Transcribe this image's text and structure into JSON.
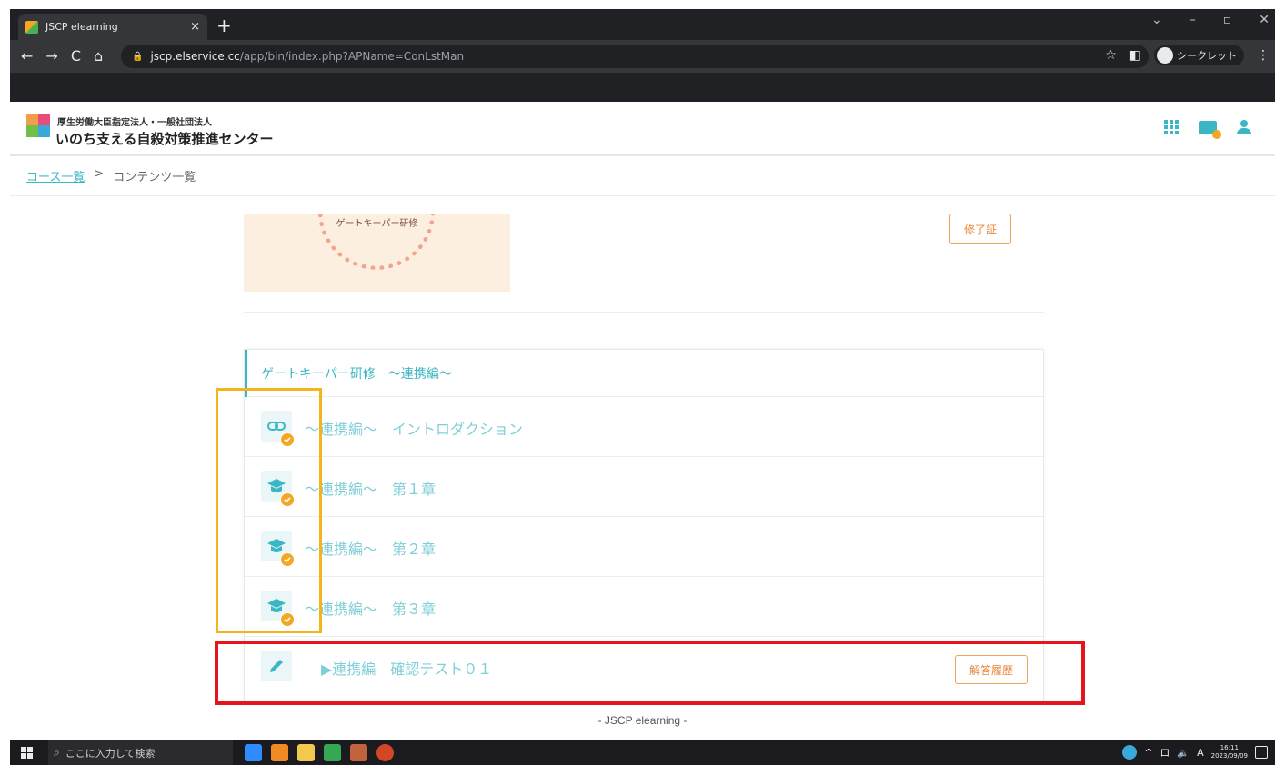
{
  "browser": {
    "tab_title": "JSCP elearning",
    "tab_close": "×",
    "new_tab": "+",
    "url_host": "jscp.elservice.cc",
    "url_path": "/app/bin/index.php?APName=ConLstMan",
    "incognito_label": "シークレット",
    "nav": {
      "back": "←",
      "forward": "→",
      "reload": "C",
      "home": "⌂"
    },
    "window": {
      "dropdown": "⌄",
      "minimize": "–",
      "restore": "▫",
      "close": "✕"
    },
    "star": "☆",
    "sidepanel": "◧",
    "menu": "⋮",
    "lock": "🔒"
  },
  "header": {
    "org_subtitle": "厚生労働大臣指定法人・一般社団法人",
    "org_name": "いのち支える自殺対策推進センター"
  },
  "breadcrumb": {
    "root": "コース一覧",
    "separator": ">",
    "current": "コンテンツ一覧"
  },
  "banner": {
    "title": "ゲートキーパー研修"
  },
  "certificate_button": "修了証",
  "course": {
    "title": "ゲートキーパー研修　～連携編～",
    "items": [
      {
        "label": "～連携編～　イントロダクション",
        "icon": "link-icon",
        "completed": true
      },
      {
        "label": "～連携編～　第１章",
        "icon": "graduation-cap-icon",
        "completed": true
      },
      {
        "label": "～連携編～　第２章",
        "icon": "graduation-cap-icon",
        "completed": true
      },
      {
        "label": "～連携編～　第３章",
        "icon": "graduation-cap-icon",
        "completed": true
      },
      {
        "label": "▶連携編　確認テスト０１",
        "icon": "pencil-icon",
        "completed": false,
        "action": "解答履歴"
      }
    ]
  },
  "footer": "- JSCP elearning -",
  "taskbar": {
    "search_placeholder": "ここに入力して検索",
    "time": "16:11",
    "date": "2023/09/09",
    "ime": "A",
    "tray_chevron": "^",
    "tray_network": "ロ",
    "tray_volume": "🔈"
  },
  "colors": {
    "accent": "#3bb6c4",
    "orange": "#f0a35a",
    "highlight_yellow": "#f2b51c",
    "highlight_red": "#e8141c"
  }
}
